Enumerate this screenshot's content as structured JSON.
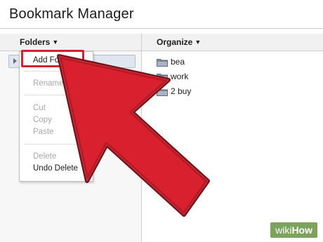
{
  "window": {
    "title": "Bookmark Manager"
  },
  "toolbar": {
    "folders_label": "Folders",
    "organize_label": "Organize",
    "caret_icon": "triangle-down-icon"
  },
  "context_menu": {
    "items": [
      {
        "label": "Add Folder...",
        "enabled": true,
        "highlighted": true
      },
      {
        "label": "Rename...",
        "enabled": false
      },
      {
        "label": "Cut",
        "enabled": false
      },
      {
        "label": "Copy",
        "enabled": false
      },
      {
        "label": "Paste",
        "enabled": false
      },
      {
        "label": "Delete",
        "enabled": false
      },
      {
        "label": "Undo Delete",
        "enabled": true
      }
    ]
  },
  "folders": [
    {
      "label": "bea",
      "icon": "folder-icon"
    },
    {
      "label": "work",
      "icon": "folder-icon"
    },
    {
      "label": "2 buy",
      "icon": "folder-icon"
    }
  ],
  "annotation": {
    "color": "#d8202e",
    "shape": "arrow-pointing-up-left"
  },
  "watermark": {
    "part1": "wiki",
    "part2": "How",
    "color": "#7da25b"
  }
}
